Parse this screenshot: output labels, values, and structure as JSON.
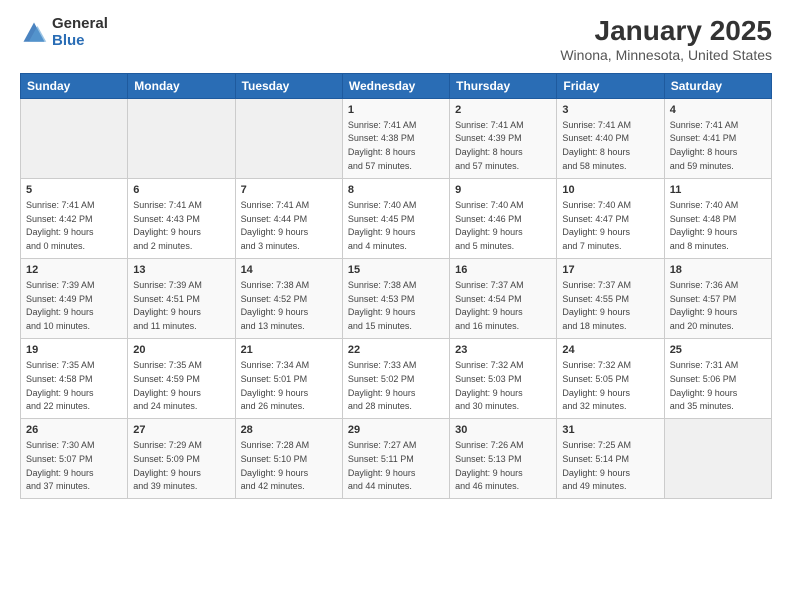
{
  "logo": {
    "general": "General",
    "blue": "Blue"
  },
  "header": {
    "title": "January 2025",
    "subtitle": "Winona, Minnesota, United States"
  },
  "weekdays": [
    "Sunday",
    "Monday",
    "Tuesday",
    "Wednesday",
    "Thursday",
    "Friday",
    "Saturday"
  ],
  "weeks": [
    [
      {
        "day": "",
        "detail": ""
      },
      {
        "day": "",
        "detail": ""
      },
      {
        "day": "",
        "detail": ""
      },
      {
        "day": "1",
        "detail": "Sunrise: 7:41 AM\nSunset: 4:38 PM\nDaylight: 8 hours\nand 57 minutes."
      },
      {
        "day": "2",
        "detail": "Sunrise: 7:41 AM\nSunset: 4:39 PM\nDaylight: 8 hours\nand 57 minutes."
      },
      {
        "day": "3",
        "detail": "Sunrise: 7:41 AM\nSunset: 4:40 PM\nDaylight: 8 hours\nand 58 minutes."
      },
      {
        "day": "4",
        "detail": "Sunrise: 7:41 AM\nSunset: 4:41 PM\nDaylight: 8 hours\nand 59 minutes."
      }
    ],
    [
      {
        "day": "5",
        "detail": "Sunrise: 7:41 AM\nSunset: 4:42 PM\nDaylight: 9 hours\nand 0 minutes."
      },
      {
        "day": "6",
        "detail": "Sunrise: 7:41 AM\nSunset: 4:43 PM\nDaylight: 9 hours\nand 2 minutes."
      },
      {
        "day": "7",
        "detail": "Sunrise: 7:41 AM\nSunset: 4:44 PM\nDaylight: 9 hours\nand 3 minutes."
      },
      {
        "day": "8",
        "detail": "Sunrise: 7:40 AM\nSunset: 4:45 PM\nDaylight: 9 hours\nand 4 minutes."
      },
      {
        "day": "9",
        "detail": "Sunrise: 7:40 AM\nSunset: 4:46 PM\nDaylight: 9 hours\nand 5 minutes."
      },
      {
        "day": "10",
        "detail": "Sunrise: 7:40 AM\nSunset: 4:47 PM\nDaylight: 9 hours\nand 7 minutes."
      },
      {
        "day": "11",
        "detail": "Sunrise: 7:40 AM\nSunset: 4:48 PM\nDaylight: 9 hours\nand 8 minutes."
      }
    ],
    [
      {
        "day": "12",
        "detail": "Sunrise: 7:39 AM\nSunset: 4:49 PM\nDaylight: 9 hours\nand 10 minutes."
      },
      {
        "day": "13",
        "detail": "Sunrise: 7:39 AM\nSunset: 4:51 PM\nDaylight: 9 hours\nand 11 minutes."
      },
      {
        "day": "14",
        "detail": "Sunrise: 7:38 AM\nSunset: 4:52 PM\nDaylight: 9 hours\nand 13 minutes."
      },
      {
        "day": "15",
        "detail": "Sunrise: 7:38 AM\nSunset: 4:53 PM\nDaylight: 9 hours\nand 15 minutes."
      },
      {
        "day": "16",
        "detail": "Sunrise: 7:37 AM\nSunset: 4:54 PM\nDaylight: 9 hours\nand 16 minutes."
      },
      {
        "day": "17",
        "detail": "Sunrise: 7:37 AM\nSunset: 4:55 PM\nDaylight: 9 hours\nand 18 minutes."
      },
      {
        "day": "18",
        "detail": "Sunrise: 7:36 AM\nSunset: 4:57 PM\nDaylight: 9 hours\nand 20 minutes."
      }
    ],
    [
      {
        "day": "19",
        "detail": "Sunrise: 7:35 AM\nSunset: 4:58 PM\nDaylight: 9 hours\nand 22 minutes."
      },
      {
        "day": "20",
        "detail": "Sunrise: 7:35 AM\nSunset: 4:59 PM\nDaylight: 9 hours\nand 24 minutes."
      },
      {
        "day": "21",
        "detail": "Sunrise: 7:34 AM\nSunset: 5:01 PM\nDaylight: 9 hours\nand 26 minutes."
      },
      {
        "day": "22",
        "detail": "Sunrise: 7:33 AM\nSunset: 5:02 PM\nDaylight: 9 hours\nand 28 minutes."
      },
      {
        "day": "23",
        "detail": "Sunrise: 7:32 AM\nSunset: 5:03 PM\nDaylight: 9 hours\nand 30 minutes."
      },
      {
        "day": "24",
        "detail": "Sunrise: 7:32 AM\nSunset: 5:05 PM\nDaylight: 9 hours\nand 32 minutes."
      },
      {
        "day": "25",
        "detail": "Sunrise: 7:31 AM\nSunset: 5:06 PM\nDaylight: 9 hours\nand 35 minutes."
      }
    ],
    [
      {
        "day": "26",
        "detail": "Sunrise: 7:30 AM\nSunset: 5:07 PM\nDaylight: 9 hours\nand 37 minutes."
      },
      {
        "day": "27",
        "detail": "Sunrise: 7:29 AM\nSunset: 5:09 PM\nDaylight: 9 hours\nand 39 minutes."
      },
      {
        "day": "28",
        "detail": "Sunrise: 7:28 AM\nSunset: 5:10 PM\nDaylight: 9 hours\nand 42 minutes."
      },
      {
        "day": "29",
        "detail": "Sunrise: 7:27 AM\nSunset: 5:11 PM\nDaylight: 9 hours\nand 44 minutes."
      },
      {
        "day": "30",
        "detail": "Sunrise: 7:26 AM\nSunset: 5:13 PM\nDaylight: 9 hours\nand 46 minutes."
      },
      {
        "day": "31",
        "detail": "Sunrise: 7:25 AM\nSunset: 5:14 PM\nDaylight: 9 hours\nand 49 minutes."
      },
      {
        "day": "",
        "detail": ""
      }
    ]
  ]
}
